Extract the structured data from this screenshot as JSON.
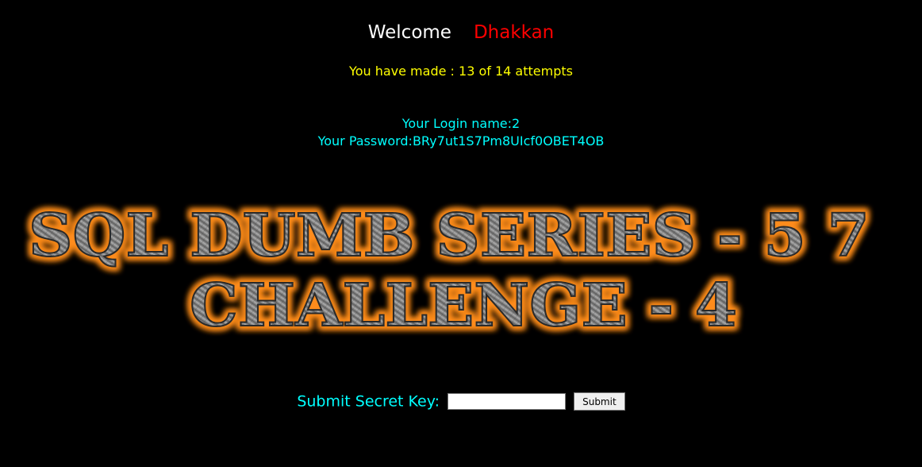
{
  "header": {
    "welcome_label": "Welcome",
    "username": "Dhakkan"
  },
  "status": {
    "attempts_text": "You have made : 13 of 14 attempts"
  },
  "credentials": {
    "login_text": "Your Login name:2",
    "password_text": "Your Password:BRy7ut1S7Pm8UIcf0OBET4OB"
  },
  "banner": {
    "line1": "SQL DUMB SERIES - 5 7",
    "line2": "CHALLENGE - 4"
  },
  "form": {
    "label": "Submit Secret Key:",
    "input_value": "",
    "submit_label": "Submit"
  },
  "colors": {
    "background": "#000000",
    "welcome": "#ffffff",
    "username": "#ff0000",
    "attempts": "#ffff00",
    "credentials": "#00ffff",
    "banner_glow": "#ff8c1a",
    "banner_metal": "#8c8c8c"
  }
}
